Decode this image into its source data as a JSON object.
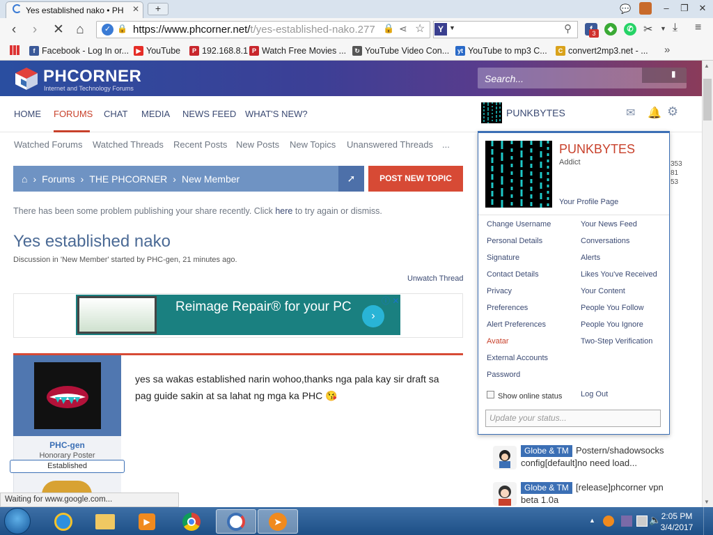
{
  "browser": {
    "tab_title": "Yes established nako • PH",
    "new_tab_label": "+",
    "url_host": "https://www.phcorner.net/",
    "url_path": "t/yes-established-nako.277",
    "search_engine": "Y",
    "ext_fb_count": "3",
    "bookmarks": [
      {
        "label": "Facebook - Log In or...",
        "icon": "f",
        "color": "#3b5998"
      },
      {
        "label": "YouTube",
        "icon": "▶",
        "color": "#e52d27"
      },
      {
        "label": "192.168.8.1",
        "icon": "P",
        "color": "#c8262c"
      },
      {
        "label": "Watch Free Movies ...",
        "icon": "P",
        "color": "#c8262c"
      },
      {
        "label": "YouTube Video Con...",
        "icon": "↻",
        "color": "#555"
      },
      {
        "label": "YouTube to mp3 C...",
        "icon": "yt",
        "color": "#2a6ac8"
      },
      {
        "label": "convert2mp3.net - ...",
        "icon": "C",
        "color": "#d9a21b"
      }
    ],
    "bookmark_overflow": "»"
  },
  "site": {
    "logo_text": "PHCORNER",
    "logo_sub": "Internet and Technology Forums",
    "search_placeholder": "Search..."
  },
  "nav": {
    "tabs": [
      "HOME",
      "FORUMS",
      "CHAT",
      "MEDIA",
      "NEWS FEED",
      "WHAT'S NEW?"
    ],
    "active": "FORUMS",
    "subnav": [
      "Watched Forums",
      "Watched Threads",
      "Recent Posts",
      "New Posts",
      "New Topics",
      "Unanswered Threads",
      "..."
    ],
    "username": "PUNKBYTES"
  },
  "breadcrumb": {
    "items": [
      "Forums",
      "THE PHCORNER",
      "New Member"
    ],
    "sep": "›",
    "post_new_topic": "POST NEW TOPIC"
  },
  "notice": {
    "before": "There has been some problem publishing your share recently. Click ",
    "link": "here",
    "after": " to try again or dismiss."
  },
  "thread": {
    "title": "Yes established nako",
    "meta": "Discussion in 'New Member' started by PHC-gen, 21 minutes ago.",
    "unwatch": "Unwatch Thread"
  },
  "ad": {
    "text": "Reimage Repair® for your PC",
    "arrow": "›",
    "close": "ⓘ ✕"
  },
  "post": {
    "username": "PHC-gen",
    "rank": "Honorary Poster",
    "badge": "Established",
    "body": "yes sa wakas established narin wohoo,thanks nga pala kay sir draft sa pag guide sakin at sa lahat ng mga ka PHC 😘"
  },
  "popup": {
    "name": "PUNKBYTES",
    "rank": "Addict",
    "profile_link": "Your Profile Page",
    "left": [
      "Change Username",
      "Personal Details",
      "Signature",
      "Contact Details",
      "Privacy",
      "Preferences",
      "Alert Preferences",
      "Avatar",
      "External Accounts",
      "Password"
    ],
    "right": [
      "Your News Feed",
      "Conversations",
      "Alerts",
      "Likes You've Received",
      "Your Content",
      "People You Follow",
      "People You Ignore",
      "Two-Step Verification"
    ],
    "active_item": "Avatar",
    "online_status": "Show online status",
    "logout": "Log Out",
    "status_placeholder": "Update your status..."
  },
  "sidebar": {
    "stats": [
      "353",
      "81",
      "53"
    ],
    "threads": [
      {
        "tag": "Globe & TM",
        "title_1": "Postern/shadowsocks",
        "title_2": "config[default]no need load..."
      },
      {
        "tag": "Globe & TM",
        "title_1": "[release]phcorner vpn",
        "title_2": "beta 1.0a"
      }
    ]
  },
  "status_bar": "Waiting for www.google.com...",
  "taskbar": {
    "time": "2:05 PM",
    "date": "3/4/2017"
  },
  "colors": {
    "accent_red": "#c8412b",
    "link_blue": "#3b4a73",
    "breadcrumb_bg": "#6f93c3",
    "button_red": "#d74a35"
  }
}
